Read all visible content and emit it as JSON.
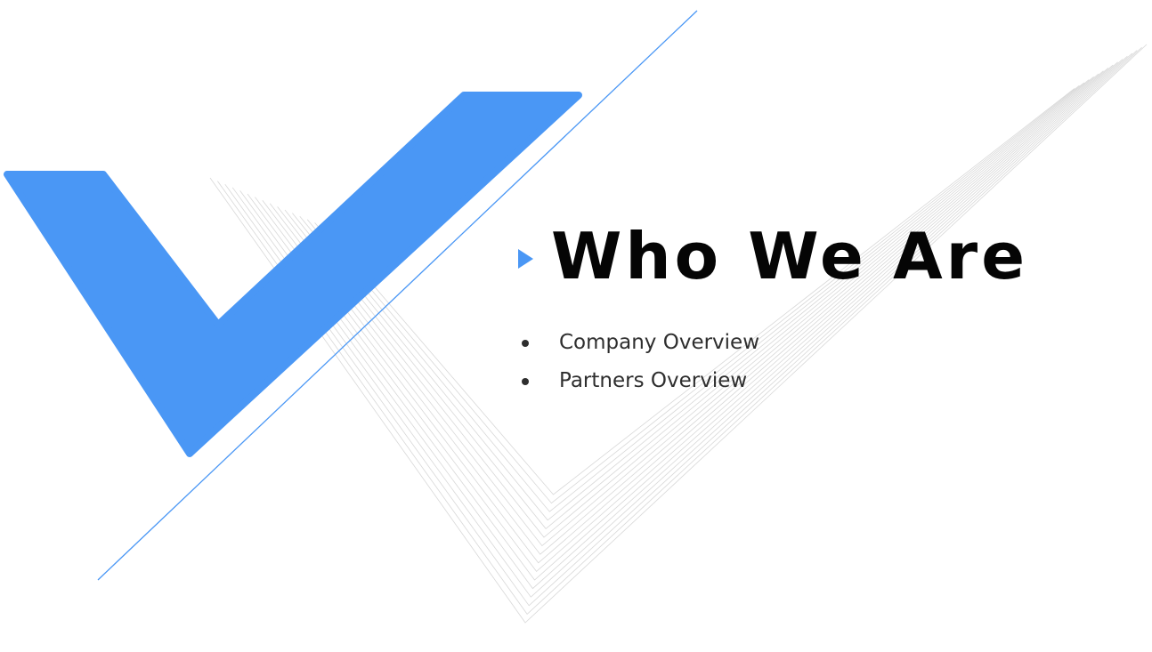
{
  "slide": {
    "title": "Who We Are",
    "bullets": [
      {
        "label": "Company Overview"
      },
      {
        "label": "Partners Overview"
      }
    ]
  },
  "colors": {
    "accent": "#4a97f5",
    "title": "#050505",
    "body_text": "#2e2e2e",
    "pattern_lines": "#d8d8d8"
  },
  "icons": {
    "title_marker": "triangle-right-icon",
    "bullet": "bullet-dot-icon",
    "logo": "checkmark-logo"
  }
}
